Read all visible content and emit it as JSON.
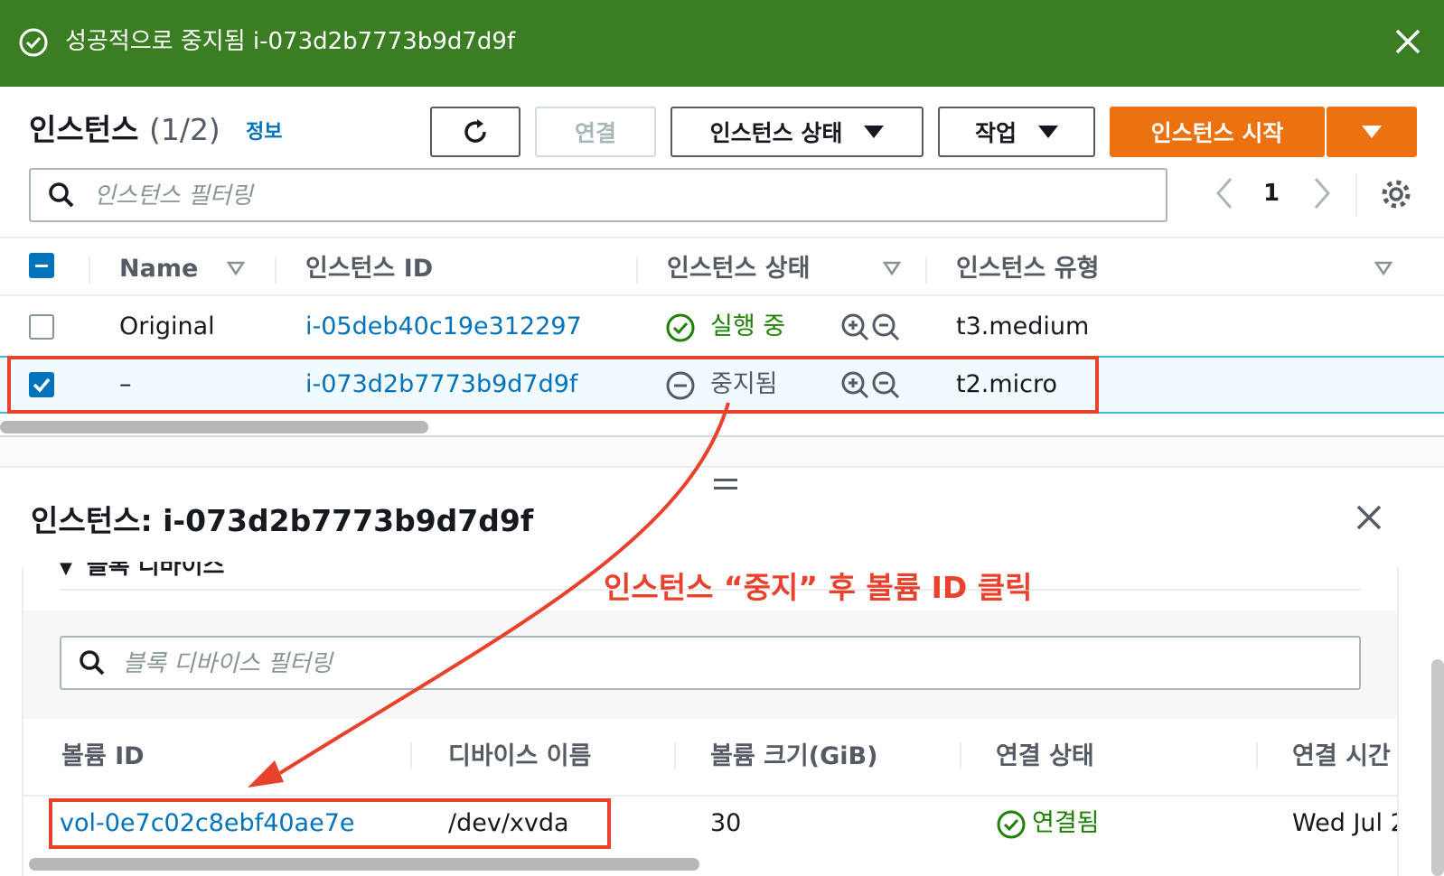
{
  "flash": {
    "message": "성공적으로 중지됨 i-073d2b7773b9d7d9f",
    "color": "#3b7d23"
  },
  "header": {
    "title": "인스턴스",
    "count": "(1/2)",
    "info_link": "정보"
  },
  "toolbar": {
    "refresh_icon": "refresh-icon",
    "connect_label": "연결",
    "instance_state_label": "인스턴스 상태",
    "actions_label": "작업",
    "launch_label": "인스턴스 시작",
    "accent": "#ec7211"
  },
  "filter": {
    "placeholder": "인스턴스 필터링"
  },
  "pagination": {
    "page": "1"
  },
  "instances_table": {
    "columns": [
      "Name",
      "인스턴스 ID",
      "인스턴스 상태",
      "인스턴스 유형"
    ],
    "rows": [
      {
        "selected": false,
        "name": "Original",
        "instance_id": "i-05deb40c19e312297",
        "state": "실행 중",
        "state_icon": "check-circle-icon",
        "type": "t3.medium"
      },
      {
        "selected": true,
        "name": "–",
        "instance_id": "i-073d2b7773b9d7d9f",
        "state": "중지됨",
        "state_icon": "minus-circle-icon",
        "type": "t2.micro"
      }
    ]
  },
  "detail": {
    "title": "인스턴스: i-073d2b7773b9d7d9f",
    "section_heading": "블록 디바이스",
    "filter_placeholder": "블록 디바이스 필터링",
    "columns": [
      "볼륨 ID",
      "디바이스 이름",
      "볼륨 크기(GiB)",
      "연결 상태",
      "연결 시간"
    ],
    "rows": [
      {
        "volume_id": "vol-0e7c02c8ebf40ae7e",
        "device_name": "/dev/xvda",
        "size": "30",
        "attach_state": "연결됨",
        "attach_time": "Wed Jul 2"
      }
    ]
  },
  "annotation": {
    "text": "인스턴스 “중지” 후 볼륨 ID 클릭",
    "color": "#e8412c"
  }
}
